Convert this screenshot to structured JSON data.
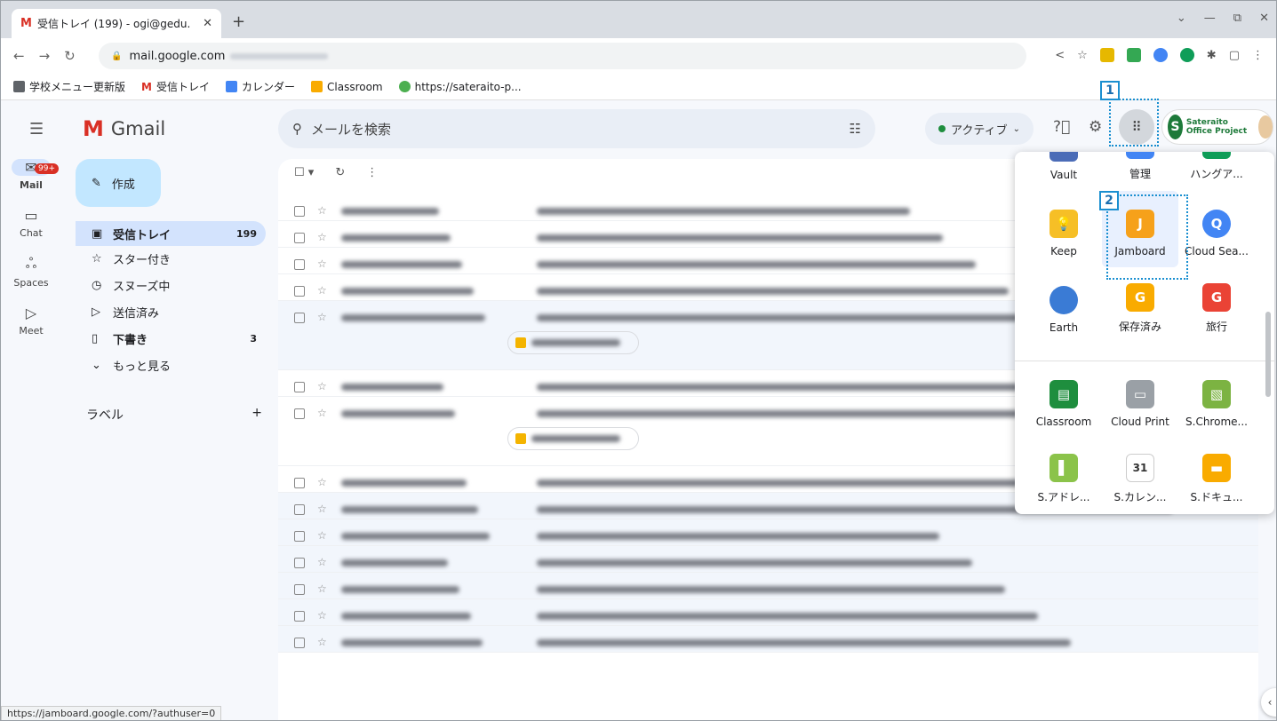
{
  "browser": {
    "tab_title": "受信トレイ (199) - ogi@gedu.",
    "tab_favicon": "M",
    "new_tab": "+",
    "url": "mail.google.com",
    "bookmarks": [
      "学校メニュー更新版",
      "受信トレイ",
      "カレンダー",
      "Classroom",
      "https://sateraito-p..."
    ]
  },
  "header": {
    "app_name": "Gmail",
    "logo_letter": "M",
    "search_placeholder": "メールを検索",
    "status": "アクティブ",
    "account_text": "Sateraito Office Project",
    "account_letter": "S"
  },
  "rail": [
    {
      "label": "Mail",
      "icon": "mail-icon",
      "glyph": "✉",
      "badge": "99+"
    },
    {
      "label": "Chat",
      "icon": "chat-icon",
      "glyph": "▭"
    },
    {
      "label": "Spaces",
      "icon": "spaces-icon",
      "glyph": "ஃ"
    },
    {
      "label": "Meet",
      "icon": "meet-icon",
      "glyph": "▷"
    }
  ],
  "compose": "作成",
  "nav": [
    {
      "label": "受信トレイ",
      "count": "199",
      "icon": "inbox-icon",
      "glyph": "▣"
    },
    {
      "label": "スター付き",
      "count": "",
      "icon": "star-icon",
      "glyph": "☆"
    },
    {
      "label": "スヌーズ中",
      "count": "",
      "icon": "clock-icon",
      "glyph": "◷"
    },
    {
      "label": "送信済み",
      "count": "",
      "icon": "send-icon",
      "glyph": "▷"
    },
    {
      "label": "下書き",
      "count": "3",
      "icon": "draft-icon",
      "glyph": "▯"
    },
    {
      "label": "もっと見る",
      "count": "",
      "icon": "chevron-down-icon",
      "glyph": "⌄"
    }
  ],
  "labels_heading": "ラベル",
  "labels_add": "+",
  "emails": [
    {
      "chip": false,
      "unread": false
    },
    {
      "chip": false,
      "unread": false
    },
    {
      "chip": false,
      "unread": false
    },
    {
      "chip": false,
      "unread": false
    },
    {
      "chip": true,
      "unread": true
    },
    {
      "chip": false,
      "unread": false
    },
    {
      "chip": true,
      "unread": false
    },
    {
      "chip": false,
      "unread": false
    },
    {
      "chip": false,
      "unread": true
    },
    {
      "chip": false,
      "unread": true
    },
    {
      "chip": false,
      "unread": true
    },
    {
      "chip": false,
      "unread": true
    },
    {
      "chip": false,
      "unread": true
    },
    {
      "chip": false,
      "unread": true
    }
  ],
  "apps_panel": {
    "items": [
      {
        "label": "Vault",
        "icon": "vault-icon",
        "color": "#4b6cb7",
        "glyph": ""
      },
      {
        "label": "管理",
        "icon": "admin-icon",
        "color": "#4285f4",
        "glyph": ""
      },
      {
        "label": "ハングア...",
        "icon": "hangouts-icon",
        "color": "#0f9d58",
        "glyph": ""
      },
      {
        "label": "Keep",
        "icon": "keep-icon",
        "color": "#f6bf26",
        "glyph": "💡"
      },
      {
        "label": "Jamboard",
        "icon": "jamboard-icon",
        "color": "#f6a11a",
        "glyph": "J"
      },
      {
        "label": "Cloud Sea...",
        "icon": "cloud-search-icon",
        "color": "#4285f4",
        "glyph": "Q"
      },
      {
        "label": "Earth",
        "icon": "earth-icon",
        "color": "#3a7bd5",
        "glyph": ""
      },
      {
        "label": "保存済み",
        "icon": "saved-icon",
        "color": "#f9ab00",
        "glyph": "G"
      },
      {
        "label": "旅行",
        "icon": "travel-icon",
        "color": "#ea4335",
        "glyph": "G"
      },
      {
        "label": "Classroom",
        "icon": "classroom-icon",
        "color": "#1e8e3e",
        "glyph": "▤"
      },
      {
        "label": "Cloud Print",
        "icon": "cloud-print-icon",
        "color": "#9aa0a6",
        "glyph": "▭"
      },
      {
        "label": "S.Chrome...",
        "icon": "s-chrome-icon",
        "color": "#7cb342",
        "glyph": "▧"
      },
      {
        "label": "S.アドレ...",
        "icon": "s-address-icon",
        "color": "#8bc34a",
        "glyph": "▌"
      },
      {
        "label": "S.カレン...",
        "icon": "s-calendar-icon",
        "color": "#ffffff",
        "glyph": "31"
      },
      {
        "label": "S.ドキュ...",
        "icon": "s-docs-icon",
        "color": "#f9ab00",
        "glyph": "▬"
      }
    ]
  },
  "callouts": [
    "1",
    "2"
  ],
  "status_url": "https://jamboard.google.com/?authuser=0"
}
